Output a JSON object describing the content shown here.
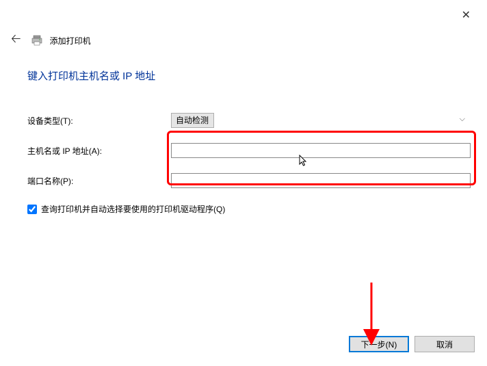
{
  "window": {
    "title": "添加打印机"
  },
  "heading": "键入打印机主机名或 IP 地址",
  "form": {
    "deviceTypeLabel": "设备类型(T):",
    "deviceTypeValue": "自动检测",
    "hostnameLabel": "主机名或 IP 地址(A):",
    "hostnameValue": "",
    "portNameLabel": "端口名称(P):",
    "portNameValue": "",
    "autoSelectLabel": "查询打印机并自动选择要使用的打印机驱动程序(Q)"
  },
  "buttons": {
    "next": "下一步(N)",
    "cancel": "取消"
  }
}
